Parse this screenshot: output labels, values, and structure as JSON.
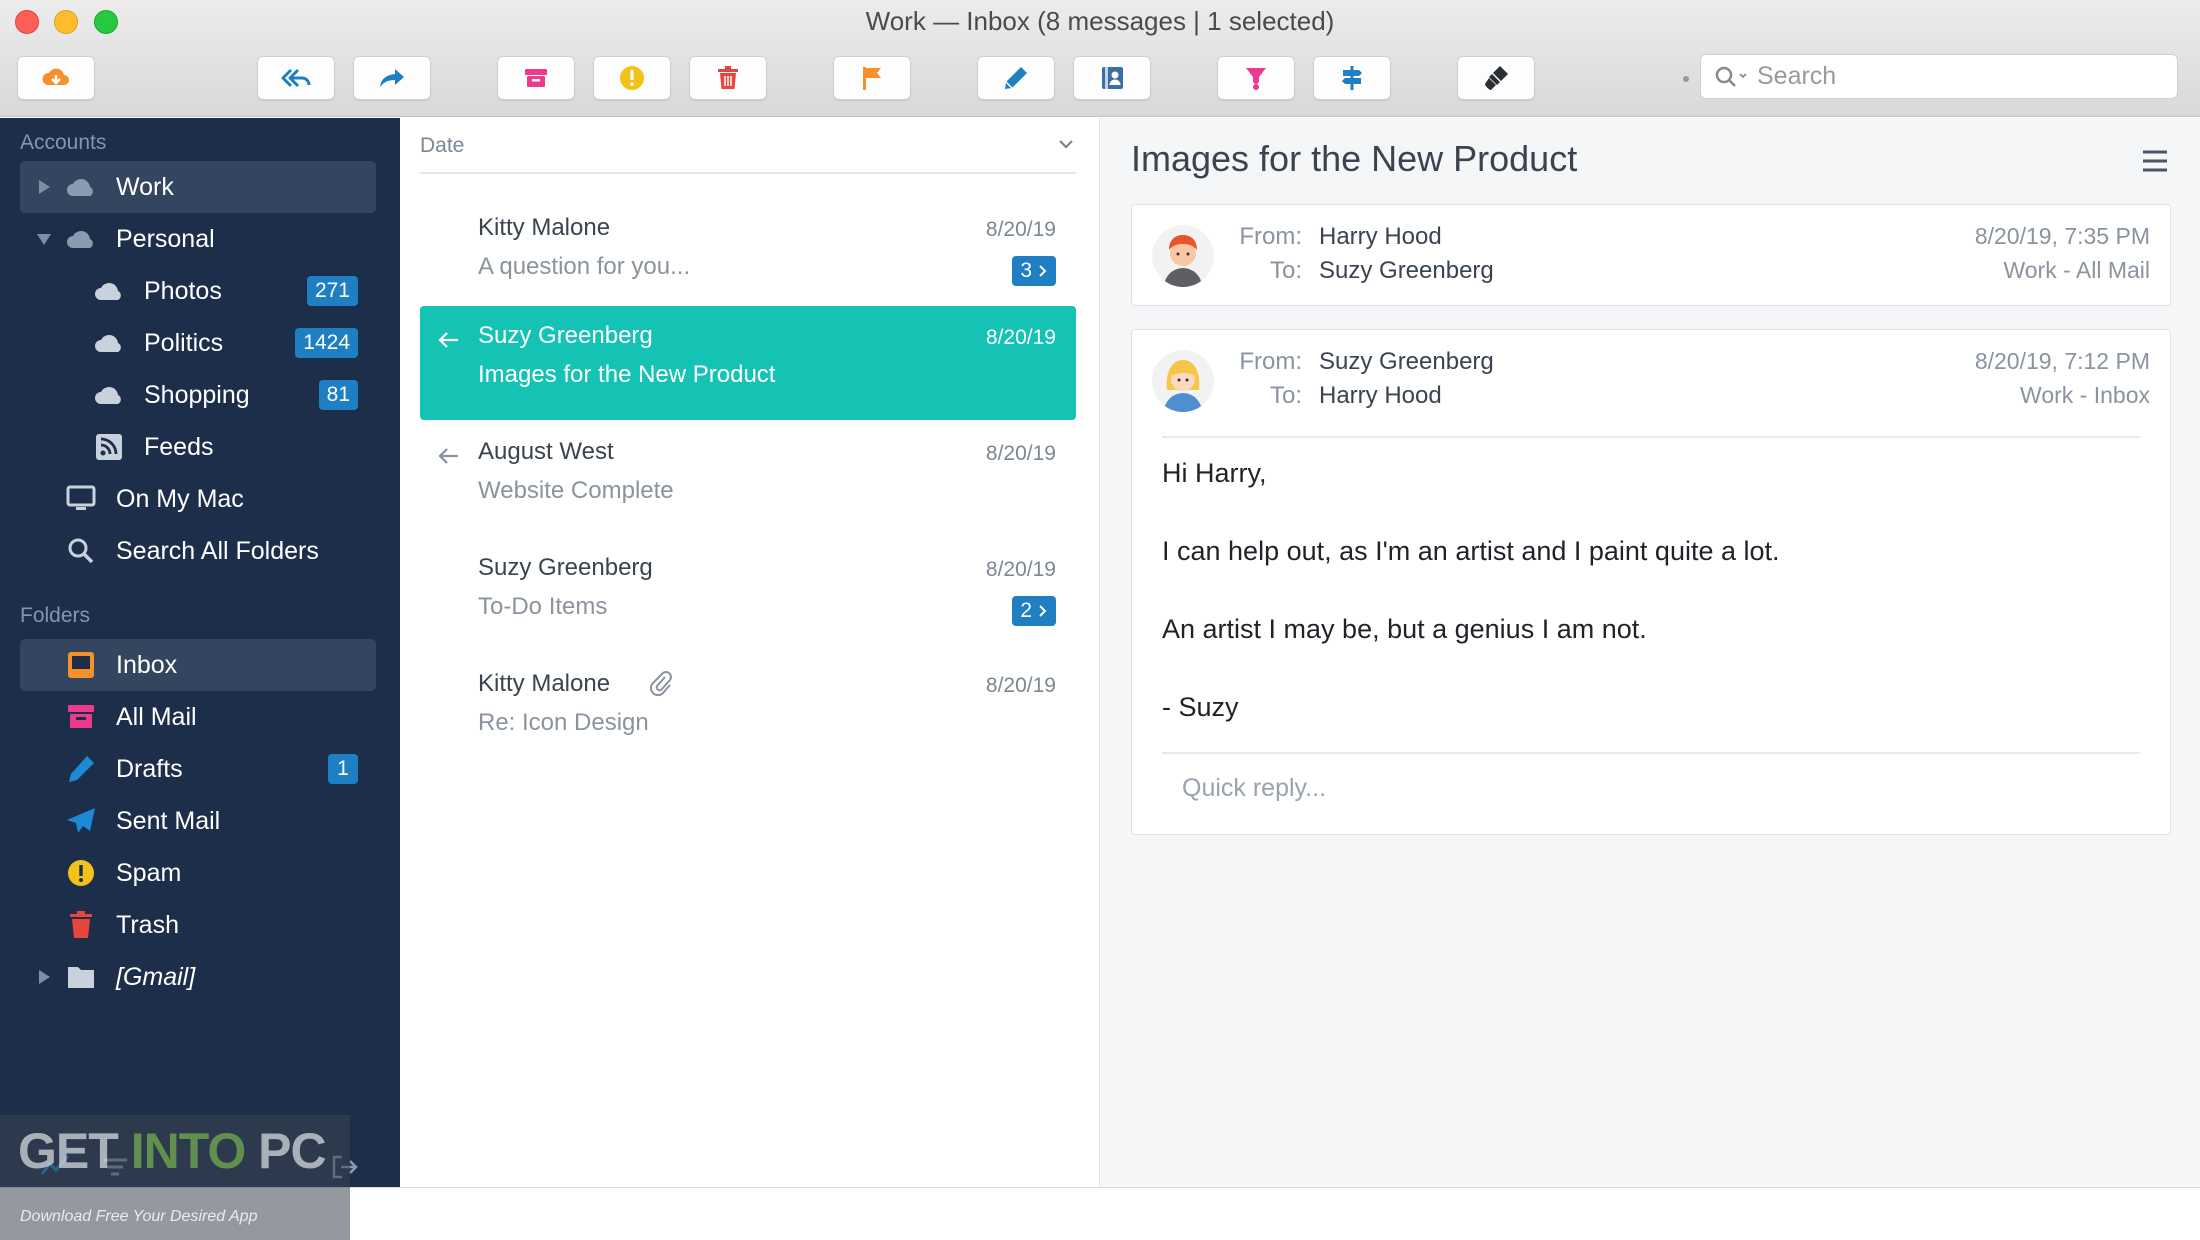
{
  "window": {
    "title": "Work — Inbox (8 messages | 1 selected)"
  },
  "toolbar": {
    "search_placeholder": "Search",
    "buttons": [
      "get-mail",
      "reply-all",
      "forward",
      "archive",
      "spam",
      "delete",
      "flag",
      "compose",
      "contacts",
      "tag",
      "move",
      "customize"
    ]
  },
  "sidebar": {
    "accounts_heading": "Accounts",
    "accounts": [
      {
        "label": "Work",
        "expanded": false,
        "active": true
      },
      {
        "label": "Personal",
        "expanded": true,
        "active": false
      },
      {
        "label": "Photos",
        "badge": "271"
      },
      {
        "label": "Politics",
        "badge": "1424"
      },
      {
        "label": "Shopping",
        "badge": "81"
      },
      {
        "label": "Feeds"
      },
      {
        "label": "On My Mac"
      },
      {
        "label": "Search All Folders"
      }
    ],
    "folders_heading": "Folders",
    "folders": [
      {
        "label": "Inbox",
        "active": true
      },
      {
        "label": "All Mail"
      },
      {
        "label": "Drafts",
        "badge": "1"
      },
      {
        "label": "Sent Mail"
      },
      {
        "label": "Spam"
      },
      {
        "label": "Trash"
      },
      {
        "label": "[Gmail]"
      }
    ]
  },
  "message_list": {
    "sort_label": "Date",
    "messages": [
      {
        "sender": "Kitty Malone",
        "subject": "A question for you...",
        "date": "8/20/19",
        "thread_count": "3"
      },
      {
        "sender": "Suzy Greenberg",
        "subject": "Images for the New Product",
        "date": "8/20/19",
        "selected": true,
        "replied": true
      },
      {
        "sender": "August West",
        "subject": "Website Complete",
        "date": "8/20/19",
        "replied": true
      },
      {
        "sender": "Suzy Greenberg",
        "subject": "To-Do Items",
        "date": "8/20/19",
        "thread_count": "2"
      },
      {
        "sender": "Kitty Malone",
        "subject": "Re: Icon Design",
        "date": "8/20/19",
        "attachment": true
      }
    ]
  },
  "reader": {
    "title": "Images for the New Product",
    "messages": [
      {
        "from_label": "From:",
        "from": "Harry Hood",
        "to_label": "To:",
        "to": "Suzy Greenberg",
        "date": "8/20/19, 7:35 PM",
        "mailbox": "Work - All Mail"
      },
      {
        "from_label": "From:",
        "from": "Suzy Greenberg",
        "to_label": "To:",
        "to": "Harry Hood",
        "date": "8/20/19, 7:12 PM",
        "mailbox": "Work - Inbox",
        "body": [
          "Hi Harry,",
          "I can help out, as I'm an artist and I paint quite a lot.",
          "An artist I may be, but a genius I am not.",
          "- Suzy"
        ],
        "quick_reply_placeholder": "Quick reply..."
      }
    ]
  },
  "watermark": {
    "text_a": "GET ",
    "text_b": "INTO",
    "text_c": " PC",
    "subtitle": "Download Free Your Desired App"
  },
  "colors": {
    "sidebar_bg": "#1c2e4a",
    "selection": "#15c3b5",
    "badge": "#1e7fc2"
  }
}
